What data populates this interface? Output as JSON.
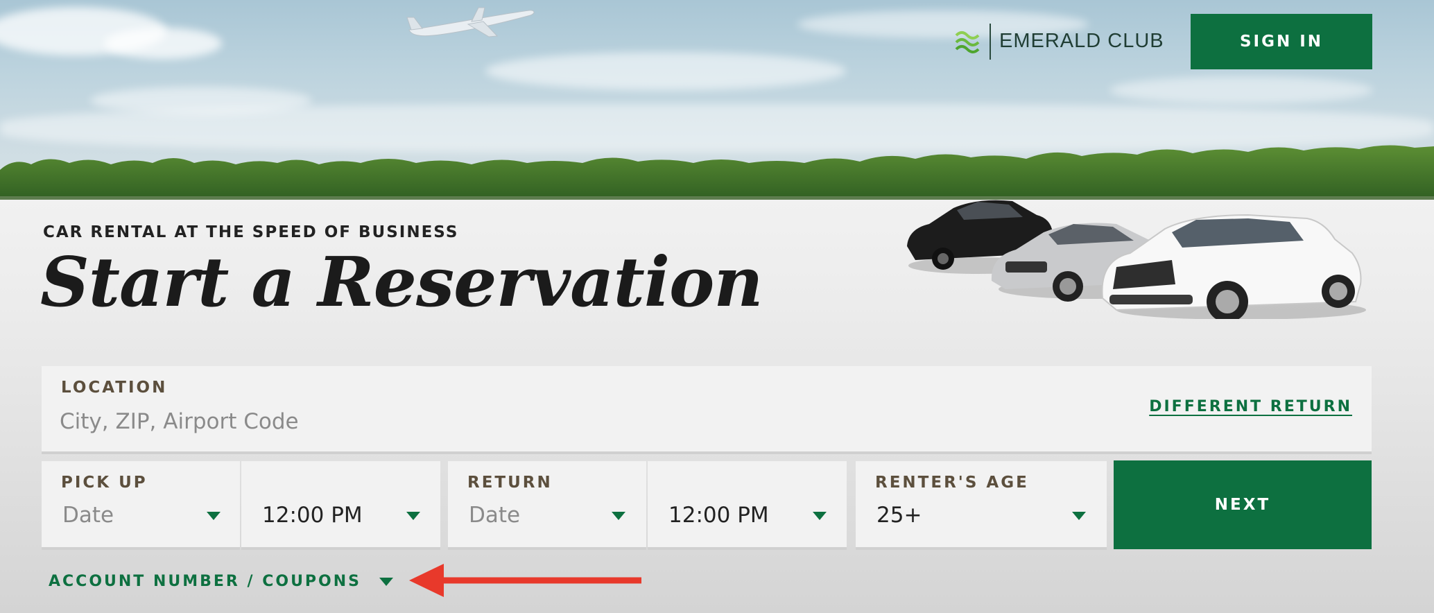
{
  "header": {
    "brand_name": "EMERALD",
    "brand_suffix": "CLUB",
    "sign_in_label": "SIGN IN"
  },
  "hero": {
    "tagline": "CAR RENTAL AT THE SPEED OF BUSINESS",
    "headline": "Start a Reservation"
  },
  "form": {
    "location": {
      "label": "LOCATION",
      "placeholder": "City, ZIP, Airport Code",
      "different_return_label": "DIFFERENT RETURN"
    },
    "pickup": {
      "label": "PICK UP",
      "date_value": "Date",
      "time_value": "12:00 PM"
    },
    "return": {
      "label": "RETURN",
      "date_value": "Date",
      "time_value": "12:00 PM"
    },
    "renters_age": {
      "label": "RENTER'S AGE",
      "value": "25+"
    },
    "next_label": "NEXT",
    "account_coupons_label": "ACCOUNT NUMBER / COUPONS"
  },
  "colors": {
    "brand_green": "#0d7040",
    "label_brown": "#5c4f3d",
    "annotation_red": "#e8392b"
  }
}
